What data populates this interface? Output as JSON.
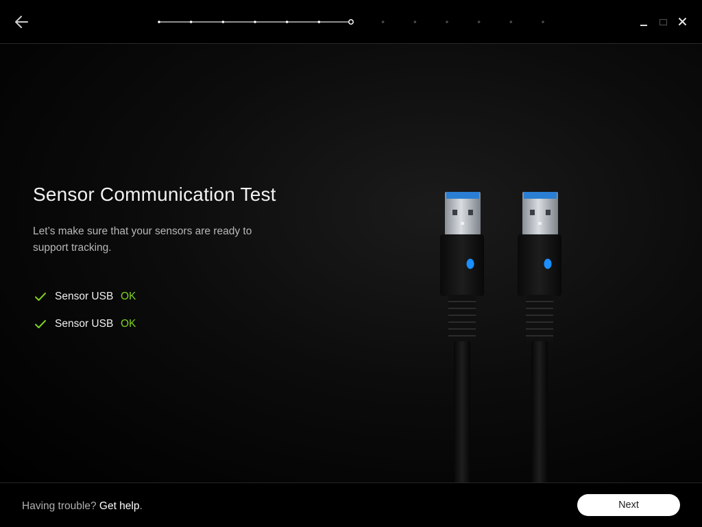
{
  "header": {
    "progress": {
      "total_steps": 13,
      "current_step": 7
    }
  },
  "main": {
    "title": "Sensor Communication Test",
    "description": "Let’s make sure that your sensors are ready to support tracking.",
    "checks": [
      {
        "label": "Sensor USB",
        "status": "OK"
      },
      {
        "label": "Sensor USB",
        "status": "OK"
      }
    ]
  },
  "footer": {
    "help_text": "Having trouble?",
    "help_link": "Get help",
    "help_suffix": ".",
    "next_label": "Next"
  },
  "colors": {
    "ok": "#7ed321",
    "led": "#1a8fff",
    "usb_blue": "#2a7fd4"
  },
  "icons": {
    "back": "arrow-left-icon",
    "check": "checkmark-icon",
    "minimize": "minimize-icon",
    "maximize": "maximize-icon",
    "close": "close-icon"
  }
}
